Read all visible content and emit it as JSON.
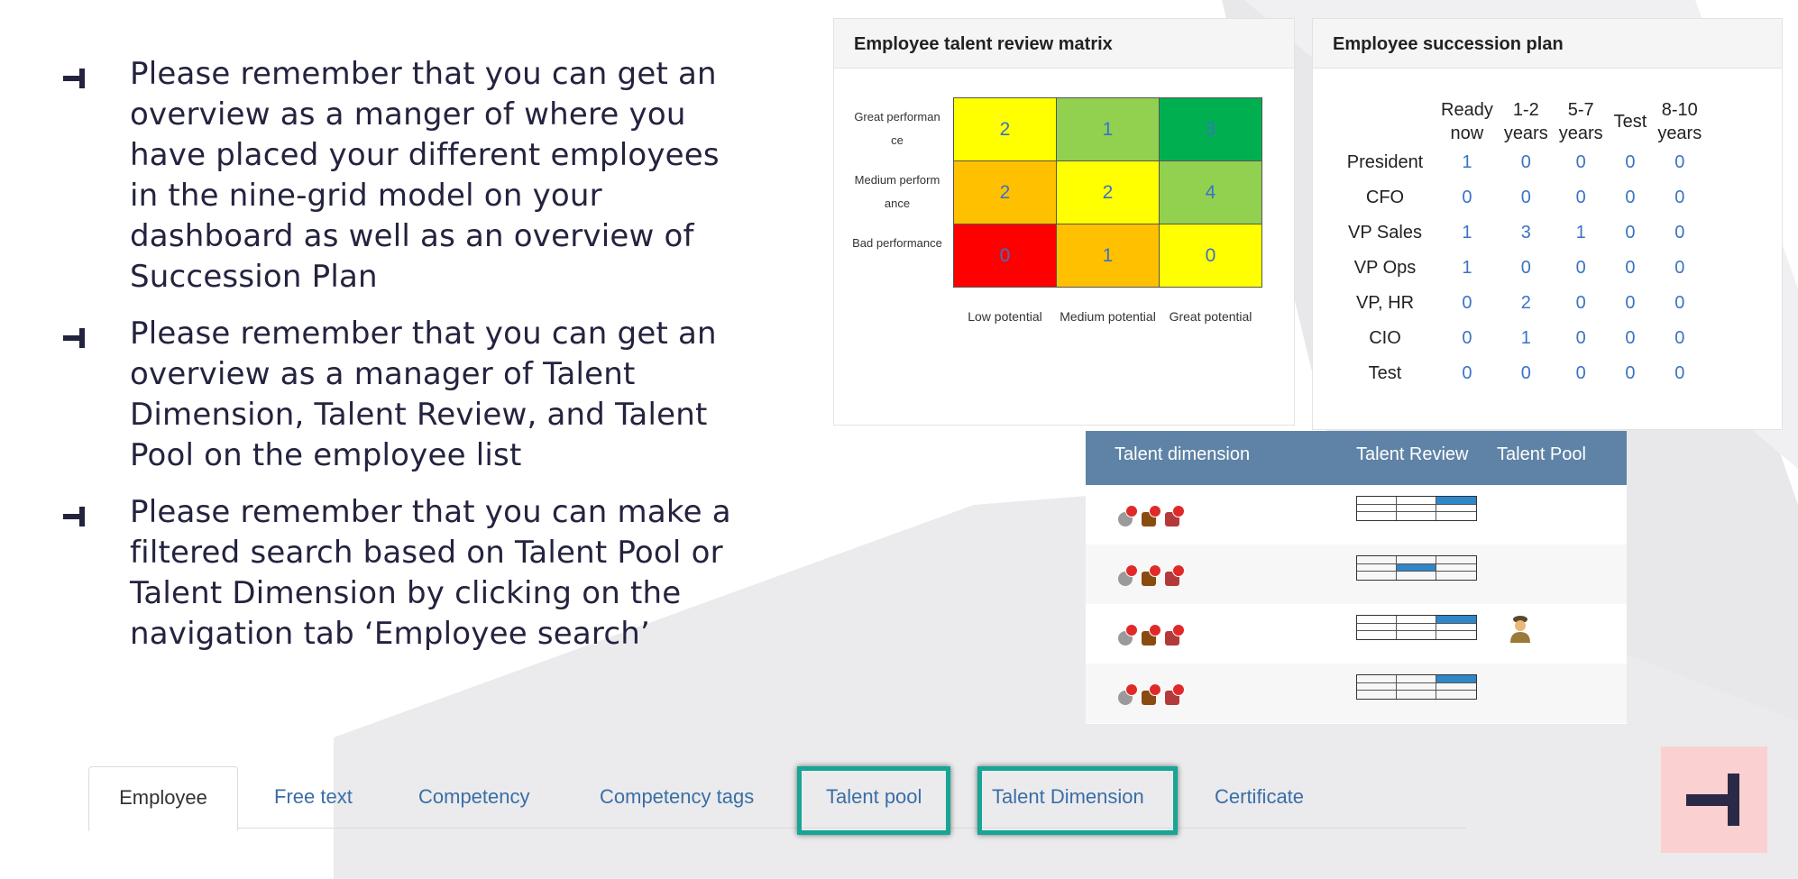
{
  "bullets": [
    "Please remember that you can get an overview as a manger of where you have placed your different employees in the nine-grid model on your dashboard as well as an overview of Succession Plan",
    "Please remember that you can get an overview as a manager of Talent Dimension, Talent Review, and Talent Pool on the employee list",
    "Please remember that you can make a filtered search based on Talent Pool or Talent Dimension by clicking on the navigation tab ‘Employee search’"
  ],
  "matrix": {
    "title": "Employee talent review matrix",
    "row_labels": [
      "Great performance",
      "Medium performance",
      "Bad performance"
    ],
    "col_labels": [
      "Low potential",
      "Medium potential",
      "Great potential"
    ],
    "rows": [
      {
        "values": [
          "2",
          "1",
          "3"
        ],
        "colors": [
          "#ffff00",
          "#92d050",
          "#00b050"
        ]
      },
      {
        "values": [
          "2",
          "2",
          "4"
        ],
        "colors": [
          "#ffc000",
          "#ffff00",
          "#92d050"
        ]
      },
      {
        "values": [
          "0",
          "1",
          "0"
        ],
        "colors": [
          "#ff0000",
          "#ffc000",
          "#ffff00"
        ]
      }
    ]
  },
  "succession": {
    "title": "Employee succession plan",
    "columns": [
      [
        "Ready",
        "now"
      ],
      [
        "1-2",
        "years"
      ],
      [
        "5-7",
        "years"
      ],
      [
        "Test",
        ""
      ],
      [
        "8-10",
        "years"
      ]
    ],
    "rows": [
      {
        "label": "President",
        "values": [
          "1",
          "0",
          "0",
          "0",
          "0"
        ]
      },
      {
        "label": "CFO",
        "values": [
          "0",
          "0",
          "0",
          "0",
          "0"
        ]
      },
      {
        "label": "VP Sales",
        "values": [
          "1",
          "3",
          "1",
          "0",
          "0"
        ]
      },
      {
        "label": "VP Ops",
        "values": [
          "1",
          "0",
          "0",
          "0",
          "0"
        ]
      },
      {
        "label": "VP, HR",
        "values": [
          "0",
          "2",
          "0",
          "0",
          "0"
        ]
      },
      {
        "label": "CIO",
        "values": [
          "0",
          "1",
          "0",
          "0",
          "0"
        ]
      },
      {
        "label": "Test",
        "values": [
          "0",
          "0",
          "0",
          "0",
          "0"
        ]
      }
    ]
  },
  "talent_list": {
    "headers": {
      "dimension": "Talent dimension",
      "review": "Talent Review",
      "pool": "Talent Pool"
    },
    "rows": [
      {
        "review_cell": 3,
        "pool": false
      },
      {
        "review_cell": 5,
        "pool": false
      },
      {
        "review_cell": 3,
        "pool": true
      },
      {
        "review_cell": 3,
        "pool": false
      }
    ]
  },
  "tabs": {
    "items": [
      "Employee",
      "Free text",
      "Competency",
      "Competency tags",
      "Talent pool",
      "Talent Dimension",
      "Certificate"
    ],
    "active": "Employee",
    "highlighted": [
      "Talent pool",
      "Talent Dimension"
    ]
  },
  "colors": {
    "accent": "#17a594",
    "header": "#5e83a6",
    "link": "#3b6ea6",
    "logo_bg": "#fbd0d0",
    "logo_fg": "#2a2946"
  }
}
